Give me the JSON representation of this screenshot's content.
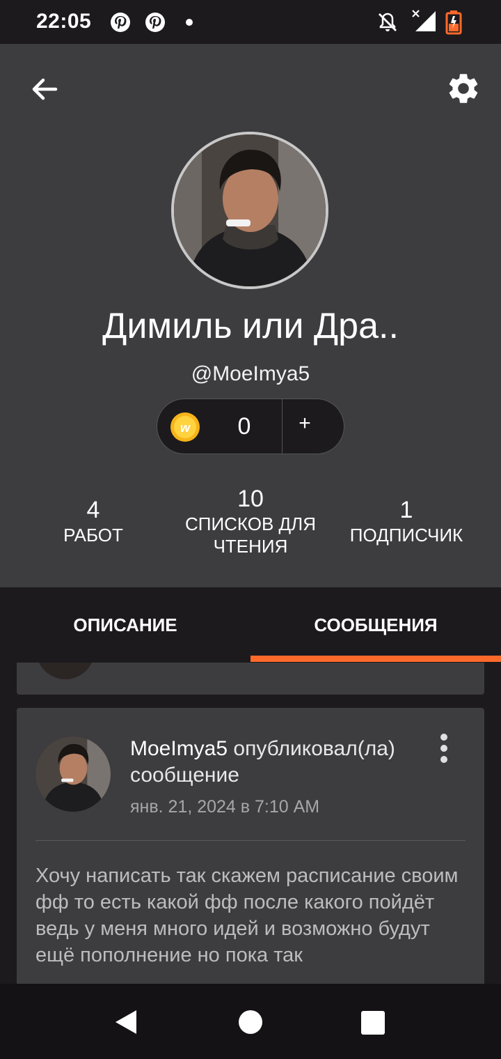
{
  "status_bar": {
    "time": "22:05",
    "left_icons": [
      "pinterest-icon",
      "pinterest-icon",
      "notification-dot-icon"
    ],
    "right_icons": [
      "notifications-off-icon",
      "signal-no-data-icon",
      "battery-low-icon"
    ],
    "battery_color": "#ff6a2b"
  },
  "profile": {
    "display_name": "Димиль или Дра..",
    "username": "@MoeImya5",
    "coins": {
      "value": "0",
      "add_label": "+"
    },
    "stats": [
      {
        "value": "4",
        "label": "РАБОТ"
      },
      {
        "value": "10",
        "label": "СПИСКОВ ДЛЯ ЧТЕНИЯ"
      },
      {
        "value": "1",
        "label": "ПОДПИСЧИК"
      }
    ]
  },
  "tabs": [
    {
      "label": "ОПИСАНИЕ",
      "active": false
    },
    {
      "label": "СООБЩЕНИЯ",
      "active": true
    }
  ],
  "post": {
    "username": "MoeImya5",
    "action": "опубликовал(ла) сообщение",
    "date": "янв. 21, 2024 в 7:10 AM",
    "body": "Хочу написать так скажем расписание своим фф то есть какой фф после какого пойдёт ведь у меня много идей и возможно будут ещё пополнение но пока так"
  },
  "colors": {
    "accent": "#ff6a2b",
    "header_bg": "#3d3c3f",
    "app_bg": "#1c1a1d"
  }
}
